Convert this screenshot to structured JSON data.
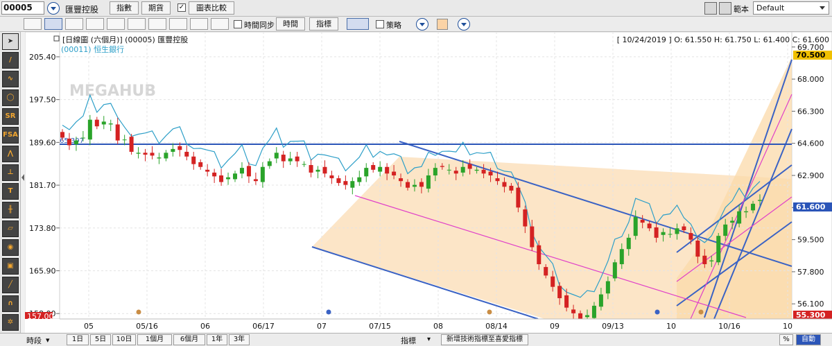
{
  "topbar": {
    "stock_code": "00005",
    "stock_name": "匯豐控股",
    "btn_index": "指數",
    "btn_futures": "期貨",
    "compare_checked": "✓",
    "btn_compare": "圖表比較",
    "template_label": "範本",
    "template_value": "Default"
  },
  "toolbar2": {
    "time_sync_label": "時間同步",
    "btn_time": "時間",
    "btn_indicator": "指標",
    "strategy_label": "策略"
  },
  "chart": {
    "header_title": "[日線圖 (六個月)] (00005) 匯豐控股",
    "compare_series": "(00011) 恒生銀行",
    "ohlc": "[ 10/24/2019 ]  O: 61.550  H: 61.750  L: 61.400  C: 61.600",
    "watermark": "MEGAHUB",
    "hline_value": "65.397",
    "left_axis_ticks": [
      "205.40",
      "197.50",
      "189.60",
      "181.70",
      "173.80",
      "165.90",
      "158.00"
    ],
    "left_axis_bottom_badge": "157.00",
    "right_axis_ticks": [
      "69.700",
      "68.000",
      "66.300",
      "64.600",
      "62.900",
      "61.200",
      "59.500",
      "57.800",
      "56.100"
    ],
    "right_axis_top_badge": "70.500",
    "right_axis_last_badge": "61.600",
    "right_axis_bottom_badge": "55.300",
    "x_ticks": [
      "05",
      "05/16",
      "06",
      "06/17",
      "07",
      "07/15",
      "08",
      "08/14",
      "09",
      "09/13",
      "10",
      "10/16",
      "10"
    ]
  },
  "bottombar": {
    "period_label": "時段",
    "periods": [
      "1日",
      "5日",
      "10日",
      "1個月",
      "6個月",
      "1年",
      "3年"
    ],
    "indicator_label": "指標",
    "add_indicator": "新增技術指標至喜愛指標",
    "percent": "%",
    "auto": "自動"
  },
  "colors": {
    "hline": "#2b55b8",
    "channel_blue": "#3a62c4",
    "channel_pink": "#e040c8",
    "fill_orange": "#fbe1bd",
    "compare_line": "#2d9fc8",
    "up_candle": "#2aa32a",
    "down_candle": "#d42222"
  },
  "chart_data": {
    "type": "candlestick",
    "title": "[日線圖 (六個月)] (00005) 匯豐控股",
    "ylim_right": [
      55.3,
      70.5
    ],
    "ylim_left": [
      157.0,
      210.0
    ],
    "horizontal_line": 65.397,
    "last_ohlc": {
      "date": "10/24/2019",
      "open": 61.55,
      "high": 61.75,
      "low": 61.4,
      "close": 61.6
    },
    "closes": [
      64.9,
      64.5,
      64.75,
      64.9,
      65.85,
      65.5,
      65.75,
      65.65,
      64.75,
      64.8,
      64.15,
      64.1,
      64.0,
      63.95,
      63.85,
      64.1,
      64.3,
      64.25,
      63.9,
      63.5,
      63.35,
      63.1,
      62.85,
      62.55,
      62.8,
      63.0,
      63.3,
      62.85,
      62.6,
      63.35,
      63.65,
      64.1,
      63.65,
      63.8,
      63.65,
      63.5,
      63.05,
      63.2,
      63.0,
      62.75,
      62.5,
      62.4,
      62.6,
      62.8,
      63.3,
      63.2,
      63.35,
      63.0,
      62.9,
      62.6,
      62.25,
      62.4,
      62.3,
      62.9,
      63.3,
      63.35,
      63.2,
      63.0,
      63.35,
      63.25,
      63.2,
      63.0,
      62.9,
      62.6,
      62.3,
      62.1,
      61.2,
      60.2,
      59.1,
      58.2,
      57.6,
      57.0,
      56.4,
      55.9,
      55.6,
      55.3,
      55.5,
      56.0,
      56.6,
      57.3,
      58.3,
      59.0,
      59.6,
      60.7,
      60.4,
      60.1,
      59.6,
      59.9,
      59.8,
      60.1,
      60.0,
      59.5,
      58.6,
      58.2,
      58.4,
      59.7,
      60.3,
      60.5,
      61.0,
      61.0,
      61.4,
      61.6
    ]
  }
}
